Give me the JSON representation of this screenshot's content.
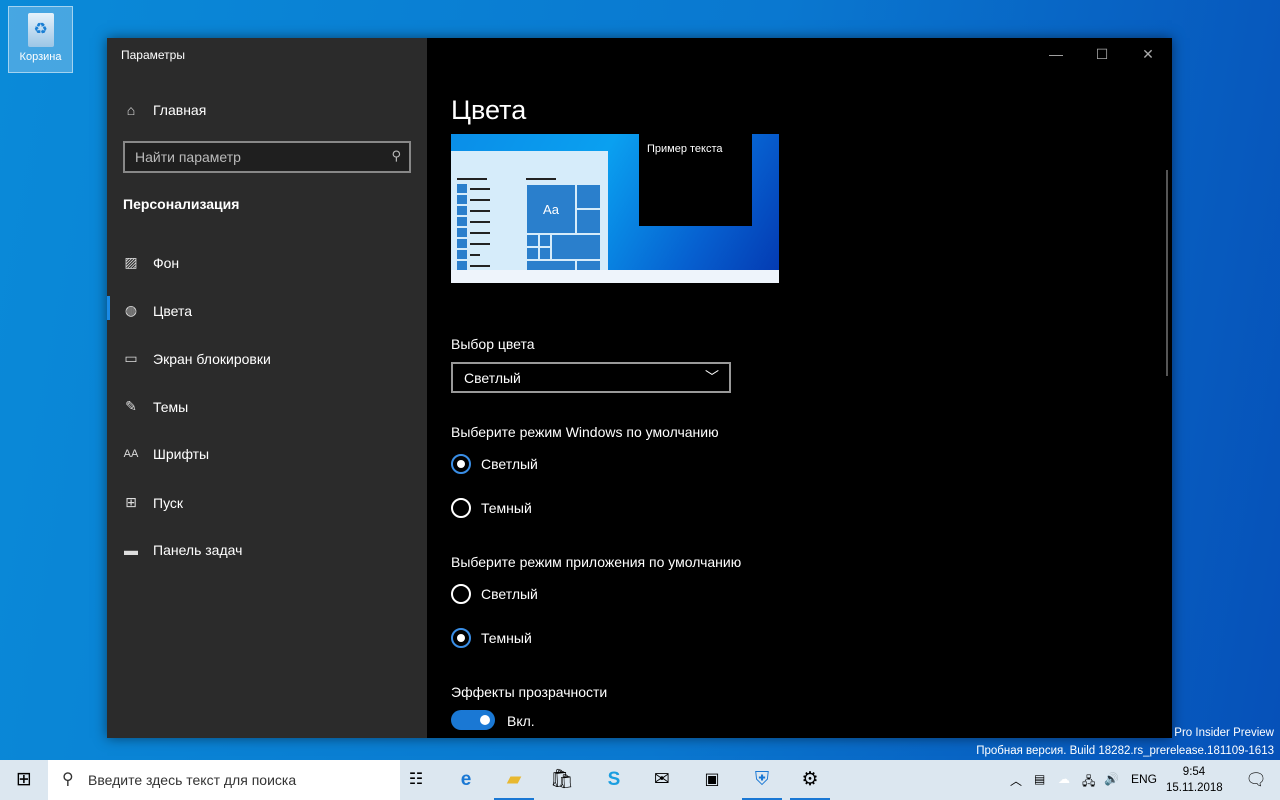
{
  "desktop": {
    "recycle_bin": "Корзина",
    "watermark_line1": "Pro Insider Preview",
    "watermark_line2": "Пробная версия. Build 18282.rs_prerelease.181109-1613"
  },
  "window": {
    "title": "Параметры",
    "controls": {
      "minimize": "—",
      "maximize": "☐",
      "close": "✕"
    }
  },
  "sidebar": {
    "home": "Главная",
    "search_placeholder": "Найти параметр",
    "section": "Персонализация",
    "items": [
      {
        "label": "Фон",
        "icon": "image-icon"
      },
      {
        "label": "Цвета",
        "icon": "palette-icon",
        "selected": true
      },
      {
        "label": "Экран блокировки",
        "icon": "lock-screen-icon"
      },
      {
        "label": "Темы",
        "icon": "themes-icon"
      },
      {
        "label": "Шрифты",
        "icon": "fonts-icon"
      },
      {
        "label": "Пуск",
        "icon": "start-icon"
      },
      {
        "label": "Панель задач",
        "icon": "taskbar-icon"
      }
    ]
  },
  "main": {
    "title": "Цвета",
    "preview": {
      "sample_text": "Пример текста",
      "tile_text": "Aa"
    },
    "color_choice": {
      "label": "Выбор цвета",
      "value": "Светлый"
    },
    "windows_mode": {
      "label": "Выберите режим Windows по умолчанию",
      "options": [
        "Светлый",
        "Темный"
      ],
      "selected": "Светлый"
    },
    "app_mode": {
      "label": "Выберите режим приложения по умолчанию",
      "options": [
        "Светлый",
        "Темный"
      ],
      "selected": "Темный"
    },
    "transparency": {
      "label": "Эффекты прозрачности",
      "state": "Вкл.",
      "on": true
    },
    "accent": "#1a78d4"
  },
  "taskbar": {
    "search_placeholder": "Введите здесь текст для поиска",
    "language": "ENG",
    "time": "9:54",
    "date": "15.11.2018"
  }
}
